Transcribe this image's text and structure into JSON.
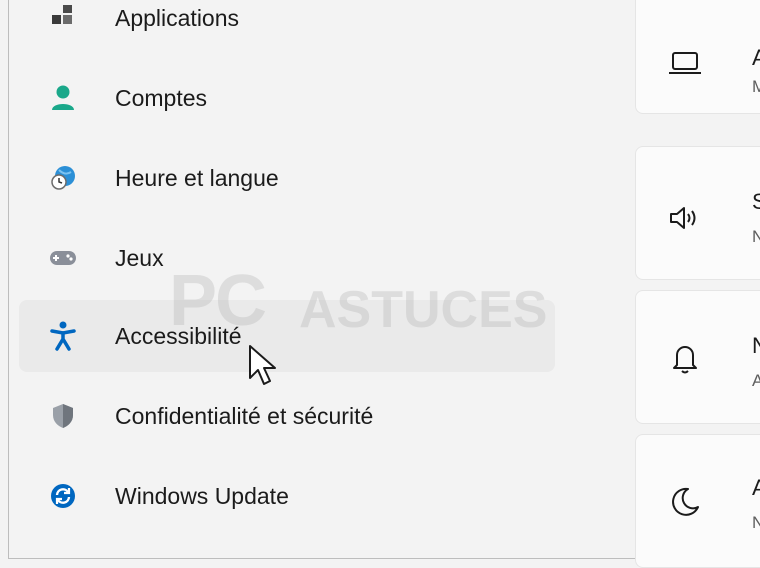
{
  "nav": {
    "items": [
      {
        "label": "Applications",
        "icon": "apps-icon"
      },
      {
        "label": "Comptes",
        "icon": "account-icon"
      },
      {
        "label": "Heure et langue",
        "icon": "time-language-icon"
      },
      {
        "label": "Jeux",
        "icon": "gamepad-icon"
      },
      {
        "label": "Accessibilité",
        "icon": "accessibility-icon",
        "selected": true
      },
      {
        "label": "Confidentialité et sécurité",
        "icon": "shield-icon"
      },
      {
        "label": "Windows Update",
        "icon": "windows-update-icon"
      }
    ]
  },
  "cards": [
    {
      "title": "A",
      "sub": "M",
      "icon": "laptop-icon"
    },
    {
      "title": "S",
      "sub": "N",
      "icon": "speaker-icon"
    },
    {
      "title": "N",
      "sub": "A",
      "icon": "bell-icon"
    },
    {
      "title": "A",
      "sub": "N",
      "icon": "moon-icon"
    }
  ],
  "watermark": {
    "part1": "PC",
    "part2": "ASTUCES"
  },
  "colors": {
    "accent_blue": "#0067c0",
    "account_teal": "#1aa88a",
    "background": "#f3f3f3"
  }
}
